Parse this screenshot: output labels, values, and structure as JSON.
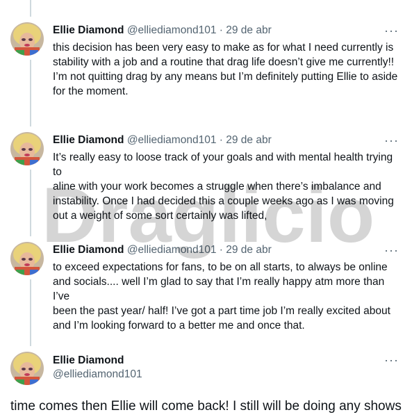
{
  "thread": {
    "author_name": "Ellie Diamond",
    "handle": "@elliediamond101",
    "separator": "·",
    "more_icon": "more-horizontal-icon",
    "tweets": [
      {
        "date": "29 de abr",
        "text": "this decision has been very easy to make as for what I need currently is\nstability with a job and a routine that drag life doesn’t give me currently!!\nI’m not quitting drag by any means but I’m definitely putting Ellie to aside\nfor the moment."
      },
      {
        "date": "29 de abr",
        "text": "It’s really easy to loose track of your goals and with mental health trying to\naline with your work becomes a struggle when there’s imbalance and\ninstability. Once I had decided this a couple weeks ago as I was moving\nout a weight of some sort certainly was lifted,"
      },
      {
        "date": "29 de abr",
        "text": "to exceed expectations for fans, to be on all starts, to always be online\nand socials.... well I’m glad to say that I’m really happy atm more than I’ve\nbeen the past year/ half! I’ve got a part time job I’m really excited about\nand I’m looking forward to a better me and once that."
      }
    ],
    "main_tweet": {
      "text": "time comes then Ellie will come back! I still will be doing any shows that’s"
    }
  },
  "watermark": {
    "text": "Draglicious"
  },
  "colors": {
    "text_primary": "#0f1419",
    "text_secondary": "#536471",
    "thread_line": "#cfd9de",
    "divider": "#eff3f4"
  }
}
